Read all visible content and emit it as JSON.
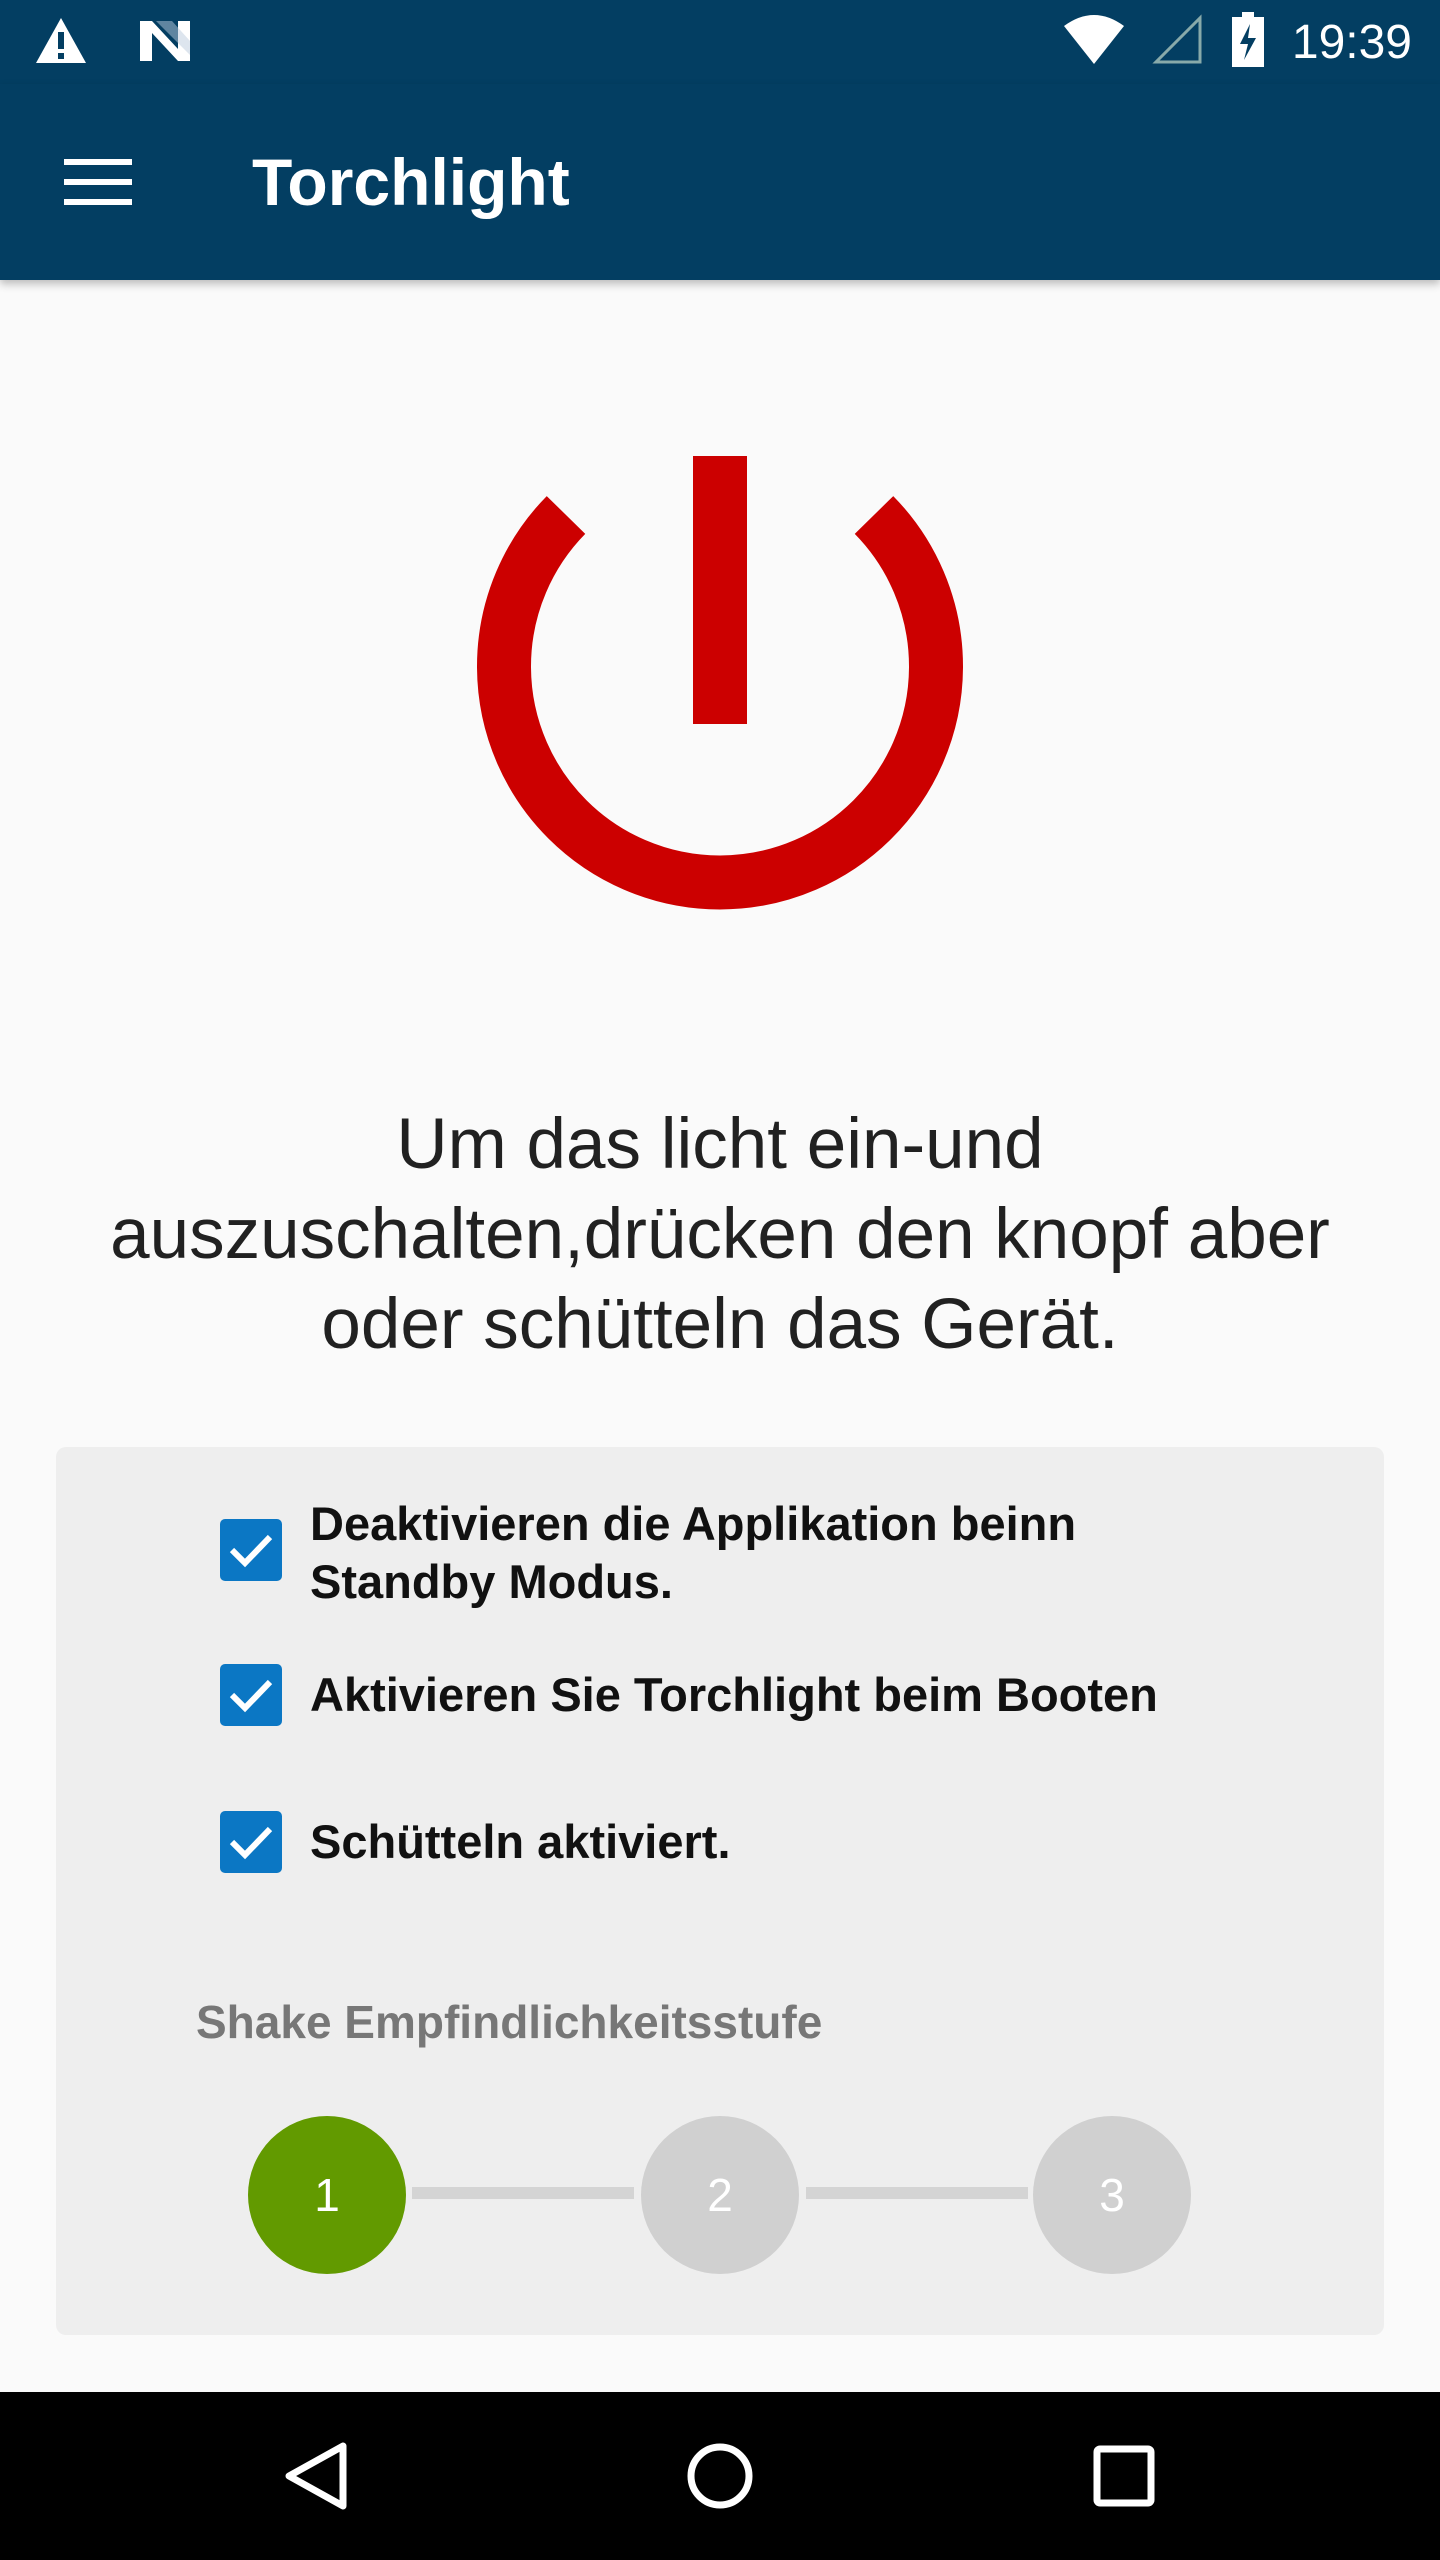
{
  "status_bar": {
    "time": "19:39",
    "icons": [
      "warning-icon",
      "n-icon",
      "wifi-icon",
      "cellular-signal-icon",
      "battery-charging-icon"
    ]
  },
  "app_bar": {
    "title": "Torchlight",
    "menu_icon": "hamburger-menu-icon"
  },
  "power_button": {
    "icon": "power-icon",
    "color": "#cc0000"
  },
  "instructions": "Um das licht ein-und auszuschalten,drücken den knopf aber oder schütteln das Gerät.",
  "settings": {
    "checkboxes": [
      {
        "label": "Deaktivieren die Applikation beinn Standby Modus.",
        "checked": true
      },
      {
        "label": "Aktivieren Sie Torchlight beim Booten",
        "checked": true
      },
      {
        "label": "Schütteln aktiviert.",
        "checked": true
      }
    ],
    "sensitivity_label": "Shake Empfindlichkeitsstufe",
    "steps": [
      "1",
      "2",
      "3"
    ],
    "selected_step": "1",
    "accent_color": "#629a00",
    "checkbox_color": "#0b77c4"
  },
  "nav_bar": {
    "buttons": [
      "back-icon",
      "home-icon",
      "recents-icon"
    ]
  },
  "colors": {
    "primary": "#033e62",
    "background": "#fafafa",
    "card": "#eeeeee"
  }
}
